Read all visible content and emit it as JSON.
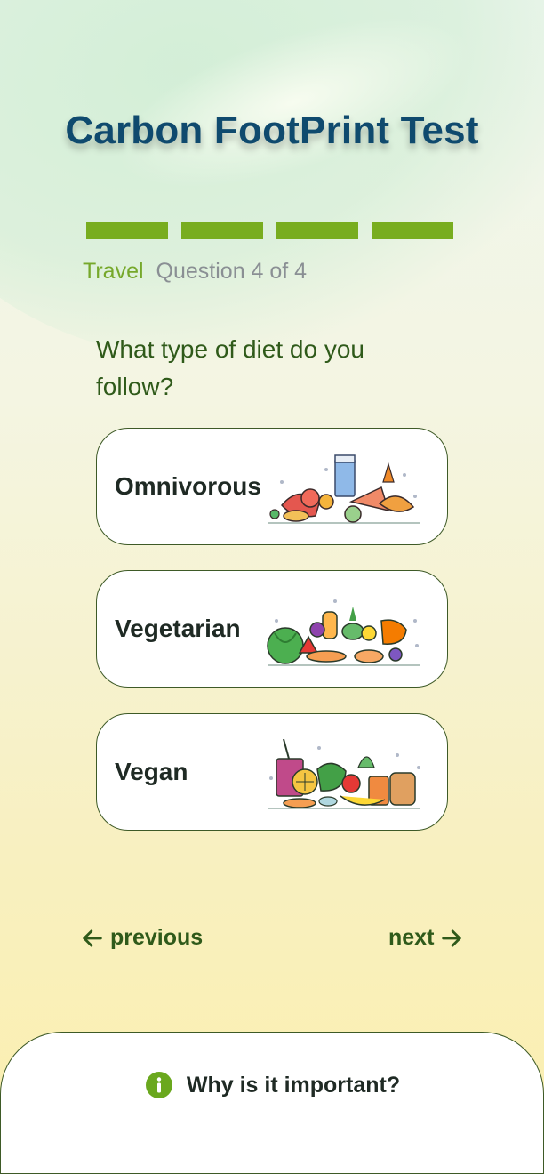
{
  "header": {
    "title": "Carbon FootPrint Test"
  },
  "progress": {
    "segments_total": 4,
    "segments_complete": 4
  },
  "question_meta": {
    "category": "Travel",
    "counter": "Question 4 of 4"
  },
  "question": {
    "text": "What type of diet do you follow?"
  },
  "options": [
    {
      "label": "Omnivorous",
      "icon": "omnivorous-food-illustration"
    },
    {
      "label": "Vegetarian",
      "icon": "vegetarian-food-illustration"
    },
    {
      "label": "Vegan",
      "icon": "vegan-food-illustration"
    }
  ],
  "navigation": {
    "previous_label": "previous",
    "next_label": "next"
  },
  "info_sheet": {
    "label": "Why is it important?",
    "icon": "info-icon"
  },
  "colors": {
    "title": "#0f4a6e",
    "accent_green": "#78ad1f",
    "dark_green": "#2f5a1a",
    "muted_text": "#8a8f94"
  }
}
